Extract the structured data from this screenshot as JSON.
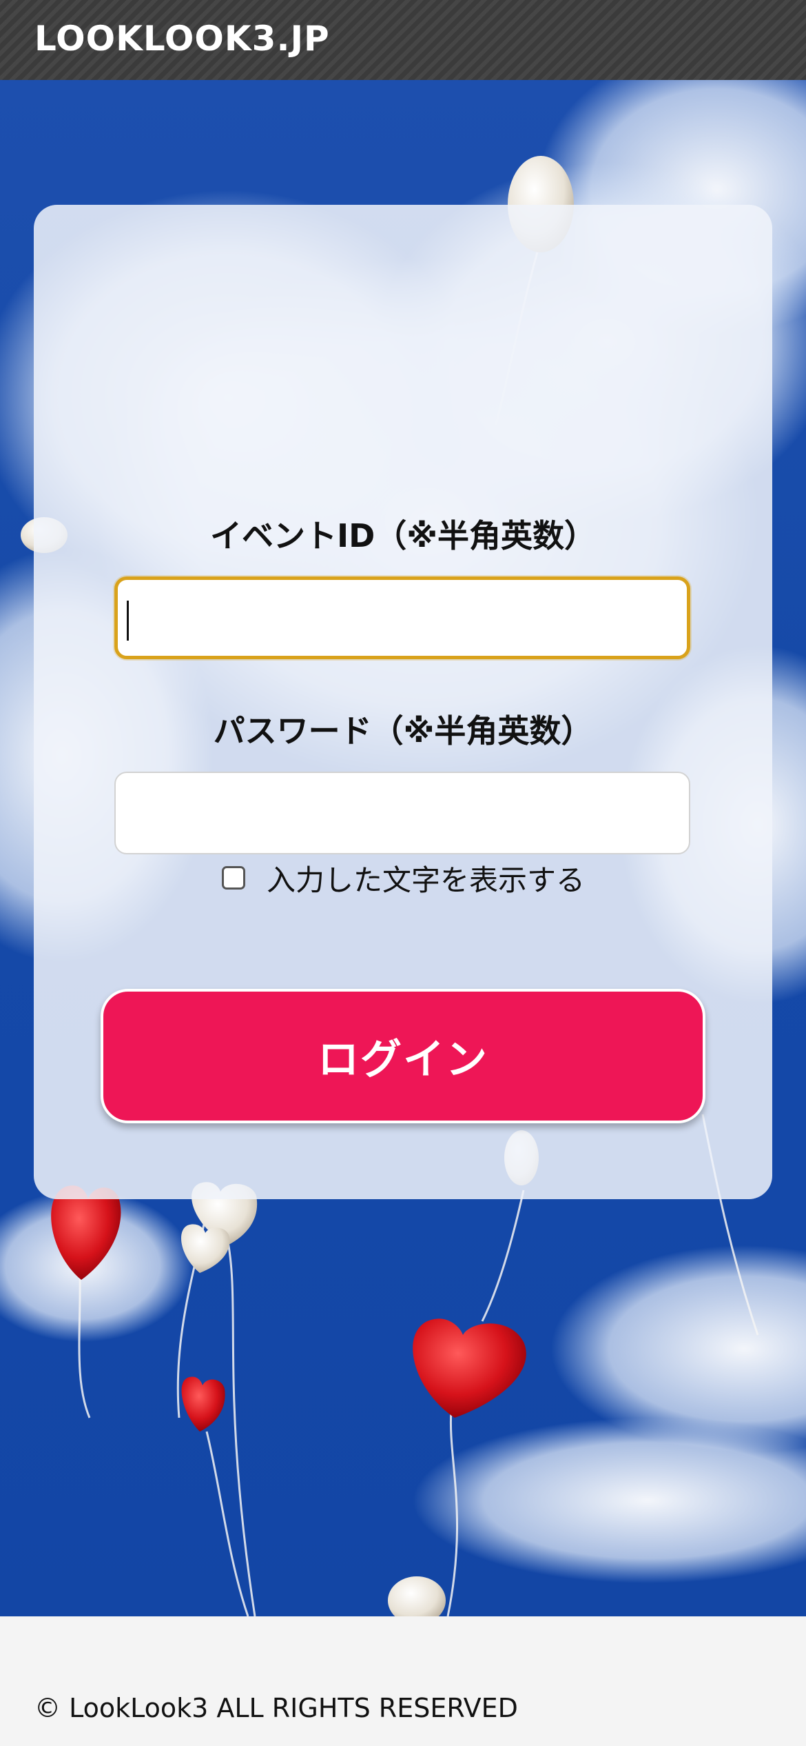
{
  "header": {
    "site_title": "LOOKLOOK3.JP"
  },
  "login_form": {
    "event_id": {
      "label": "イベントID（※半角英数）",
      "value": ""
    },
    "password": {
      "label": "パスワード（※半角英数）",
      "value": ""
    },
    "show_password": {
      "label": "入力した文字を表示する",
      "checked": false
    },
    "login_button_label": "ログイン"
  },
  "footer": {
    "copyright": "© LookLook3 ALL RIGHTS RESERVED"
  },
  "colors": {
    "header_bg": "#3b3b3b",
    "sky_blue": "#1448a8",
    "card_bg": "#f0f3fa",
    "focus_border": "#d9a21b",
    "login_button": "#ee1656",
    "footer_bg": "#f4f4f4"
  },
  "icons": {
    "show_password_checkbox": "checkbox-unchecked"
  }
}
